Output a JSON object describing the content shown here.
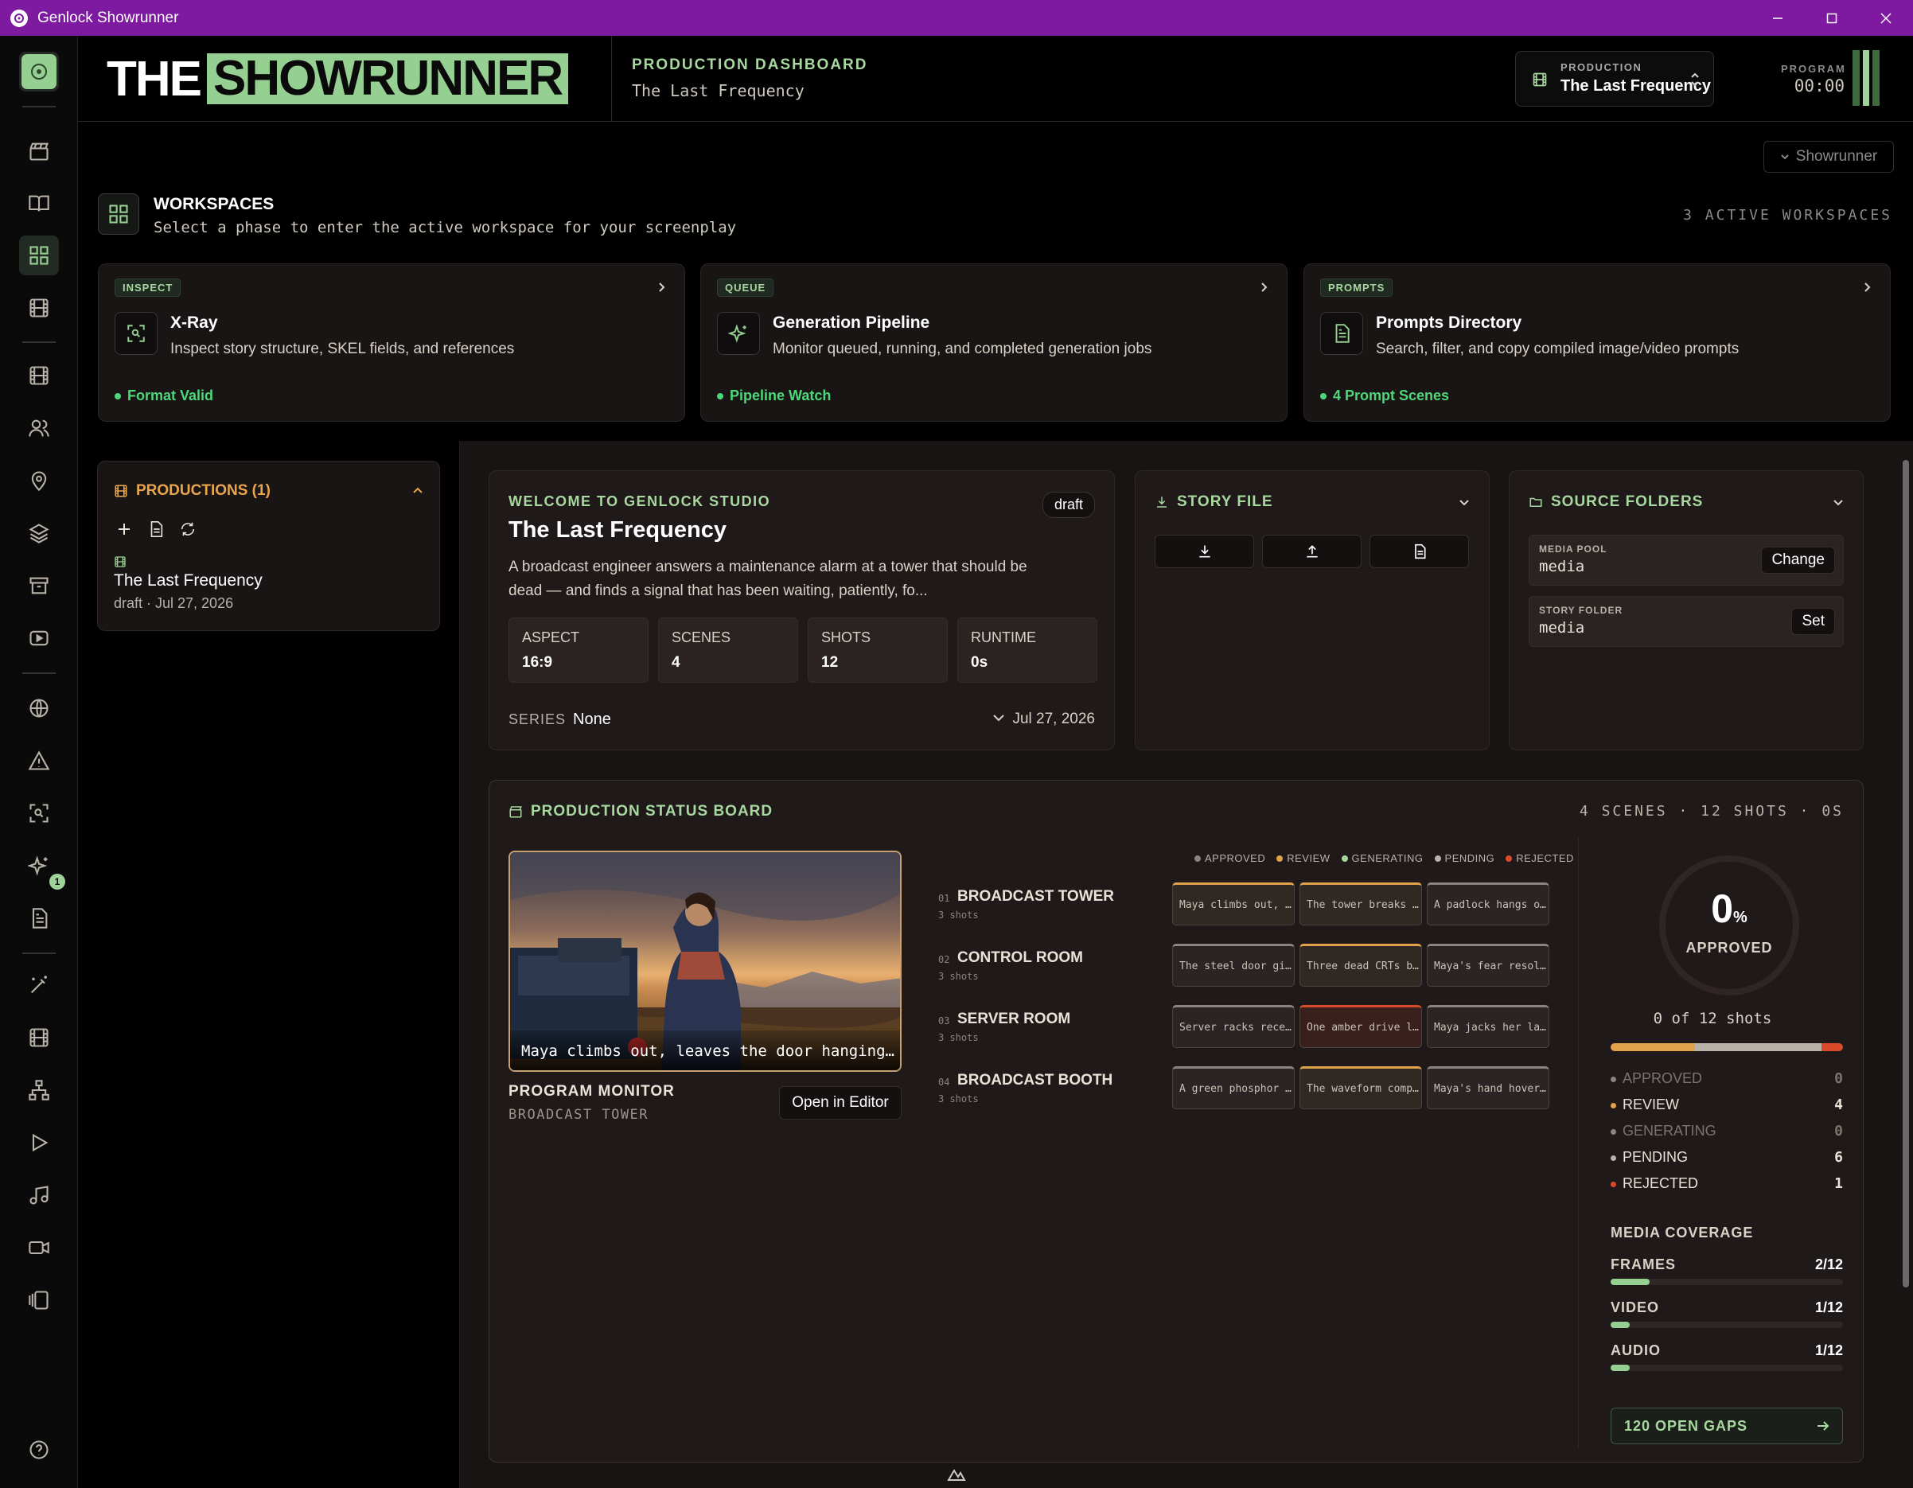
{
  "window": {
    "title": "Genlock Showrunner"
  },
  "header": {
    "logo_the": "THE",
    "logo_showrunner": "SHOWRUNNER",
    "dashboard_title": "PRODUCTION DASHBOARD",
    "dashboard_subtitle": "The Last Frequency",
    "production_label": "PRODUCTION",
    "production_value": "The Last Frequency",
    "program_label": "PROGRAM",
    "program_time": "00:00"
  },
  "showrunner_toggle": "Showrunner",
  "workspaces": {
    "title": "WORKSPACES",
    "subtitle": "Select a phase to enter the active workspace for your screenplay",
    "count": "3 ACTIVE WORKSPACES",
    "cards": [
      {
        "tag": "INSPECT",
        "name": "X-Ray",
        "desc": "Inspect story structure, SKEL fields, and references",
        "status": "Format Valid",
        "icon": "xray-scan-icon"
      },
      {
        "tag": "QUEUE",
        "name": "Generation Pipeline",
        "desc": "Monitor queued, running, and completed generation jobs",
        "status": "Pipeline Watch",
        "icon": "sparkles-icon"
      },
      {
        "tag": "PROMPTS",
        "name": "Prompts Directory",
        "desc": "Search, filter, and copy compiled image/video prompts",
        "status": "4 Prompt Scenes",
        "icon": "document-icon"
      }
    ]
  },
  "productions": {
    "title": "PRODUCTIONS (1)",
    "item_name": "The Last Frequency",
    "item_meta": "draft · Jul 27, 2026"
  },
  "welcome": {
    "kicker": "WELCOME TO GENLOCK STUDIO",
    "title": "The Last Frequency",
    "badge": "draft",
    "description": "A broadcast engineer answers a maintenance alarm at a tower that should be dead — and finds a signal that has been waiting, patiently, fo...",
    "stats": [
      {
        "label": "ASPECT",
        "value": "16:9"
      },
      {
        "label": "SCENES",
        "value": "4"
      },
      {
        "label": "SHOTS",
        "value": "12"
      },
      {
        "label": "RUNTIME",
        "value": "0s"
      }
    ],
    "series_label": "SERIES",
    "series_value": "None",
    "date": "Jul 27, 2026"
  },
  "story_file": {
    "title": "STORY FILE"
  },
  "source_folders": {
    "title": "SOURCE FOLDERS",
    "media_pool_label": "MEDIA POOL",
    "media_pool_value": "media",
    "media_pool_btn": "Change",
    "story_folder_label": "STORY FOLDER",
    "story_folder_value": "media",
    "story_folder_btn": "Set"
  },
  "board": {
    "title": "PRODUCTION STATUS BOARD",
    "summary": "4 SCENES · 12 SHOTS · 0S",
    "monitor_caption": "Maya climbs out, leaves the door hanging…",
    "monitor_title": "PROGRAM MONITOR",
    "monitor_sub": "BROADCAST TOWER",
    "open_editor": "Open in Editor",
    "legend": [
      {
        "label": "APPROVED",
        "color": "#8a8480"
      },
      {
        "label": "REVIEW",
        "color": "#e0a24a"
      },
      {
        "label": "GENERATING",
        "color": "#a8d8a0"
      },
      {
        "label": "PENDING",
        "color": "#b8b2a8"
      },
      {
        "label": "REJECTED",
        "color": "#d84a2a"
      }
    ],
    "scenes": [
      {
        "num": "01",
        "name": "BROADCAST TOWER",
        "sub": "3 shots",
        "shots": [
          {
            "text": "Maya climbs out, …",
            "status": "review"
          },
          {
            "text": "The tower breaks …",
            "status": "review"
          },
          {
            "text": "A padlock hangs o…",
            "status": "pending"
          }
        ]
      },
      {
        "num": "02",
        "name": "CONTROL ROOM",
        "sub": "3 shots",
        "shots": [
          {
            "text": "The steel door gi…",
            "status": "pending"
          },
          {
            "text": "Three dead CRTs b…",
            "status": "review"
          },
          {
            "text": "Maya's fear resol…",
            "status": "pending"
          }
        ]
      },
      {
        "num": "03",
        "name": "SERVER ROOM",
        "sub": "3 shots",
        "shots": [
          {
            "text": "Server racks rece…",
            "status": "pending"
          },
          {
            "text": "One amber drive l…",
            "status": "rejected"
          },
          {
            "text": "Maya jacks her la…",
            "status": "pending"
          }
        ]
      },
      {
        "num": "04",
        "name": "BROADCAST BOOTH",
        "sub": "3 shots",
        "shots": [
          {
            "text": "A green phosphor …",
            "status": "pending"
          },
          {
            "text": "The waveform comp…",
            "status": "review"
          },
          {
            "text": "Maya's hand hover…",
            "status": "pending"
          }
        ]
      }
    ],
    "approved_pct": "0",
    "approved_pct_unit": "%",
    "approved_label": "APPROVED",
    "of_shots": "0 of 12 shots",
    "status_counts": [
      {
        "label": "APPROVED",
        "value": "0",
        "color": "#8a8480",
        "muted": true
      },
      {
        "label": "REVIEW",
        "value": "4",
        "color": "#e0a24a",
        "muted": false
      },
      {
        "label": "GENERATING",
        "value": "0",
        "color": "#8a8480",
        "muted": true
      },
      {
        "label": "PENDING",
        "value": "6",
        "color": "#b8b2a8",
        "muted": false
      },
      {
        "label": "REJECTED",
        "value": "1",
        "color": "#d84a2a",
        "muted": false
      }
    ],
    "media_coverage_title": "MEDIA COVERAGE",
    "coverage": [
      {
        "label": "FRAMES",
        "value": "2/12",
        "fraction": 0.1667
      },
      {
        "label": "VIDEO",
        "value": "1/12",
        "fraction": 0.0833
      },
      {
        "label": "AUDIO",
        "value": "1/12",
        "fraction": 0.0833
      }
    ],
    "gaps": "120 OPEN GAPS"
  },
  "colors": {
    "accent": "#96cf92",
    "warning": "#e8a54c",
    "titlebar": "#7d1aa0",
    "ok": "#4ed67a"
  }
}
